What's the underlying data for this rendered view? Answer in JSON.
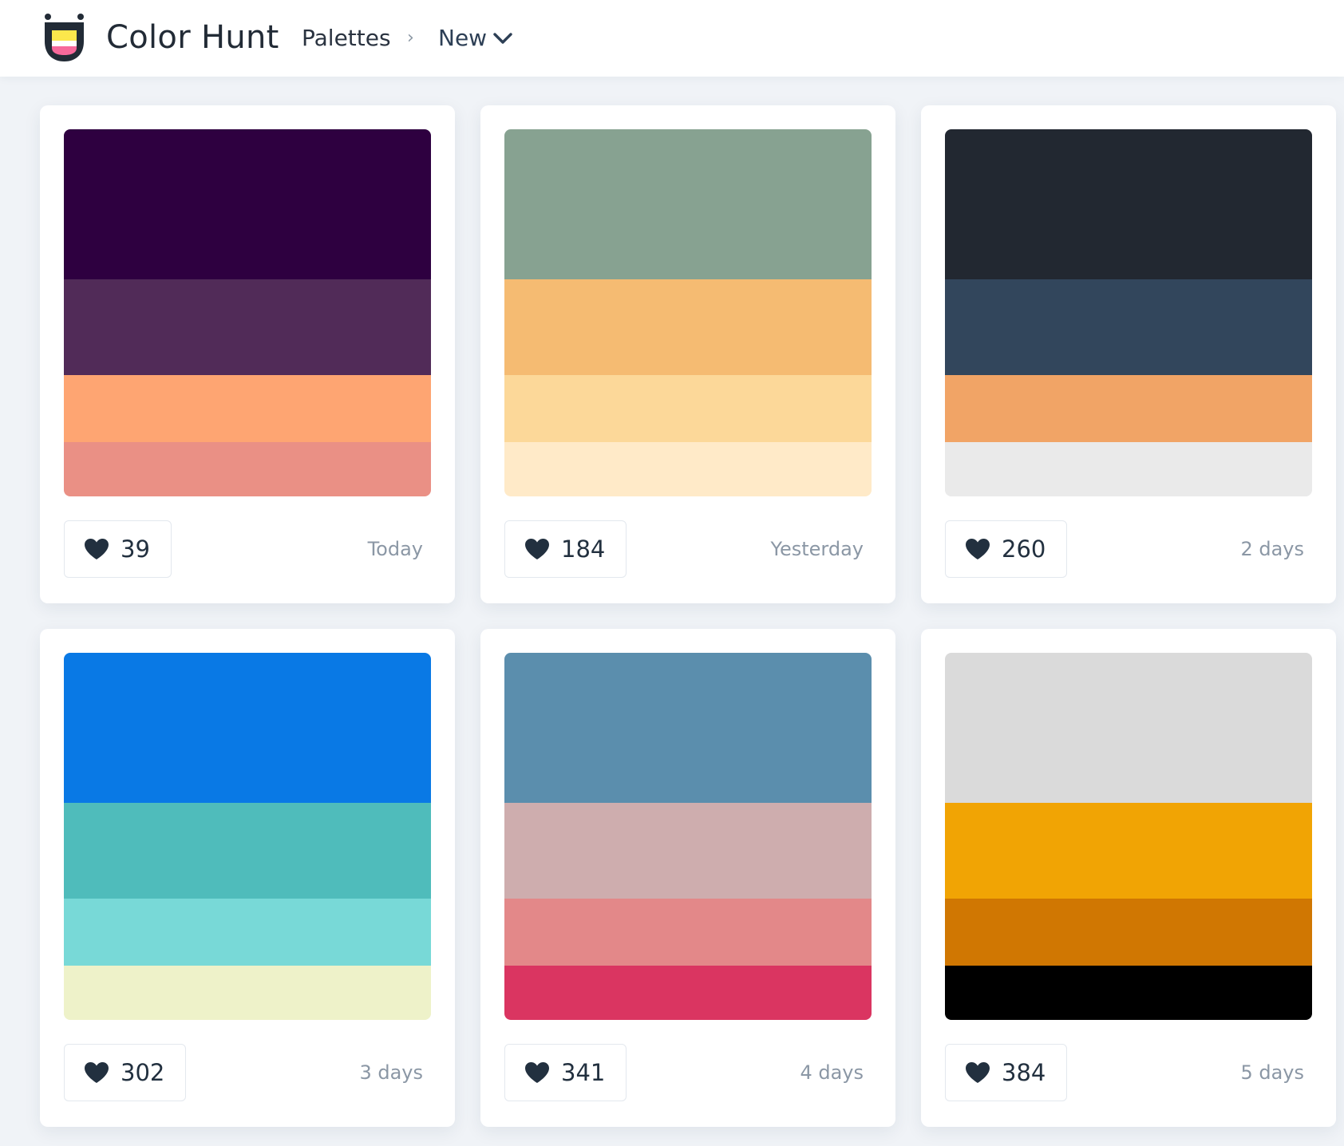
{
  "header": {
    "brand": "Color Hunt",
    "nav_palettes": "Palettes",
    "crumb_separator": "›",
    "nav_new": "New",
    "logo_colors": [
      "#fce74c",
      "#ffffff",
      "#f7699b"
    ]
  },
  "palettes": [
    {
      "likes": "39",
      "date": "Today",
      "colors": [
        "#2e0040",
        "#512b58",
        "#fea572",
        "#ea9085"
      ]
    },
    {
      "likes": "184",
      "date": "Yesterday",
      "colors": [
        "#87a291",
        "#f5bb72",
        "#fcd899",
        "#ffeac8"
      ]
    },
    {
      "likes": "260",
      "date": "2 days",
      "colors": [
        "#222831",
        "#32465c",
        "#f1a466",
        "#eaeaea"
      ]
    },
    {
      "likes": "302",
      "date": "3 days",
      "colors": [
        "#0979e5",
        "#4fbcbb",
        "#78d9d7",
        "#eef2c9"
      ]
    },
    {
      "likes": "341",
      "date": "4 days",
      "colors": [
        "#5b8ead",
        "#ceadae",
        "#e38889",
        "#da3561"
      ]
    },
    {
      "likes": "384",
      "date": "5 days",
      "colors": [
        "#dadada",
        "#f1a404",
        "#d07702",
        "#000000"
      ]
    }
  ]
}
